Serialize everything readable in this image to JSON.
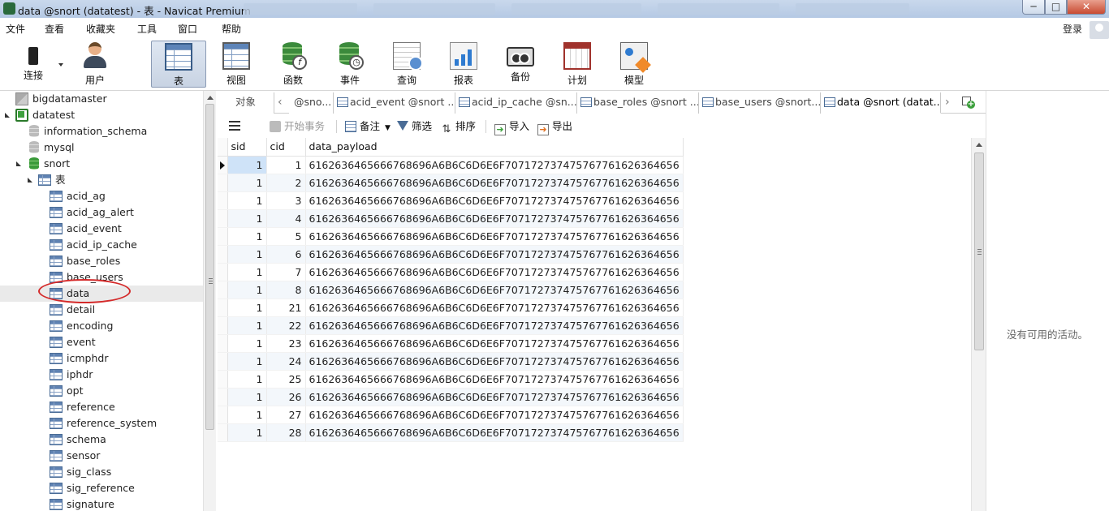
{
  "window": {
    "title": "data @snort (datatest) - 表 - Navicat Premium",
    "minimize": "─",
    "maximize": "□",
    "close": "✕"
  },
  "menu": [
    "文件",
    "查看",
    "收藏夹",
    "工具",
    "窗口",
    "帮助"
  ],
  "login_label": "登录",
  "toolbar": [
    {
      "label": "连接",
      "icon": "plug-icon"
    },
    {
      "label": "用户",
      "icon": "user-icon"
    },
    {
      "label": "表",
      "icon": "table-icon",
      "active": true
    },
    {
      "label": "视图",
      "icon": "glasses-icon"
    },
    {
      "label": "函数",
      "icon": "function-icon"
    },
    {
      "label": "事件",
      "icon": "event-clock-icon"
    },
    {
      "label": "查询",
      "icon": "query-icon"
    },
    {
      "label": "报表",
      "icon": "report-icon"
    },
    {
      "label": "备份",
      "icon": "backup-icon"
    },
    {
      "label": "计划",
      "icon": "calendar-icon"
    },
    {
      "label": "模型",
      "icon": "model-icon"
    }
  ],
  "tree": {
    "connections": [
      {
        "name": "bigdatamaster"
      },
      {
        "name": "datatest",
        "databases": [
          {
            "name": "information_schema"
          },
          {
            "name": "mysql"
          },
          {
            "name": "snort",
            "group": "表",
            "tables": [
              "acid_ag",
              "acid_ag_alert",
              "acid_event",
              "acid_ip_cache",
              "base_roles",
              "base_users",
              "data",
              "detail",
              "encoding",
              "event",
              "icmphdr",
              "iphdr",
              "opt",
              "reference",
              "reference_system",
              "schema",
              "sensor",
              "sig_class",
              "sig_reference",
              "signature"
            ]
          }
        ]
      }
    ],
    "selected_table": "data"
  },
  "tabs": [
    {
      "label": "对象",
      "type": "objects"
    },
    {
      "label": "@sno...",
      "type": "table"
    },
    {
      "label": "acid_event @snort ...",
      "type": "table"
    },
    {
      "label": "acid_ip_cache @sn...",
      "type": "table"
    },
    {
      "label": "base_roles @snort ...",
      "type": "table"
    },
    {
      "label": "base_users @snort...",
      "type": "table"
    },
    {
      "label": "data @snort (datat...",
      "type": "table",
      "active": true
    }
  ],
  "subtoolbar": {
    "begin_transaction": "开始事务",
    "memo": "备注",
    "filter": "筛选",
    "sort": "排序",
    "import": "导入",
    "export": "导出"
  },
  "grid": {
    "columns": [
      "sid",
      "cid",
      "data_payload"
    ],
    "rows": [
      [
        "1",
        "1",
        "616263646566676869 6A6B6C6D6E6F70717273747576776162636465 6"
      ],
      [
        "1",
        "2",
        ""
      ],
      [
        "1",
        "3",
        ""
      ],
      [
        "1",
        "4",
        ""
      ],
      [
        "1",
        "5",
        ""
      ],
      [
        "1",
        "6",
        ""
      ],
      [
        "1",
        "7",
        ""
      ],
      [
        "1",
        "8",
        ""
      ],
      [
        "1",
        "21",
        ""
      ],
      [
        "1",
        "22",
        ""
      ],
      [
        "1",
        "23",
        ""
      ],
      [
        "1",
        "24",
        ""
      ],
      [
        "1",
        "25",
        ""
      ],
      [
        "1",
        "26",
        ""
      ],
      [
        "1",
        "27",
        ""
      ],
      [
        "1",
        "28",
        ""
      ]
    ],
    "payload": "6162636465666768696A6B6C6D6E6F707172737475767761626364656"
  },
  "right_panel": {
    "no_activity": "没有可用的活动。"
  }
}
